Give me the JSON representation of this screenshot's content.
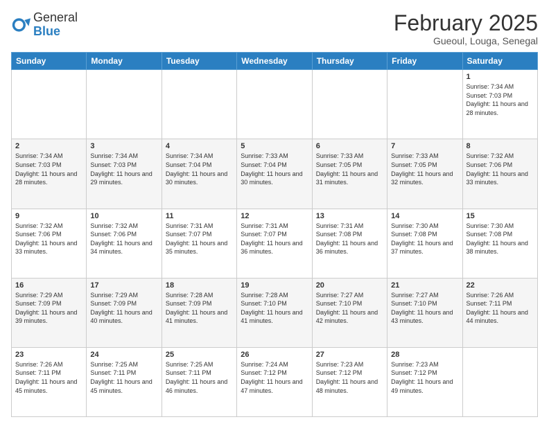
{
  "header": {
    "logo_general": "General",
    "logo_blue": "Blue",
    "month_title": "February 2025",
    "location": "Gueoul, Louga, Senegal"
  },
  "days_of_week": [
    "Sunday",
    "Monday",
    "Tuesday",
    "Wednesday",
    "Thursday",
    "Friday",
    "Saturday"
  ],
  "weeks": [
    [
      {
        "day": "",
        "info": ""
      },
      {
        "day": "",
        "info": ""
      },
      {
        "day": "",
        "info": ""
      },
      {
        "day": "",
        "info": ""
      },
      {
        "day": "",
        "info": ""
      },
      {
        "day": "",
        "info": ""
      },
      {
        "day": "1",
        "info": "Sunrise: 7:34 AM\nSunset: 7:03 PM\nDaylight: 11 hours and 28 minutes."
      }
    ],
    [
      {
        "day": "2",
        "info": "Sunrise: 7:34 AM\nSunset: 7:03 PM\nDaylight: 11 hours and 28 minutes."
      },
      {
        "day": "3",
        "info": "Sunrise: 7:34 AM\nSunset: 7:03 PM\nDaylight: 11 hours and 29 minutes."
      },
      {
        "day": "4",
        "info": "Sunrise: 7:34 AM\nSunset: 7:04 PM\nDaylight: 11 hours and 30 minutes."
      },
      {
        "day": "5",
        "info": "Sunrise: 7:33 AM\nSunset: 7:04 PM\nDaylight: 11 hours and 30 minutes."
      },
      {
        "day": "6",
        "info": "Sunrise: 7:33 AM\nSunset: 7:05 PM\nDaylight: 11 hours and 31 minutes."
      },
      {
        "day": "7",
        "info": "Sunrise: 7:33 AM\nSunset: 7:05 PM\nDaylight: 11 hours and 32 minutes."
      },
      {
        "day": "8",
        "info": "Sunrise: 7:32 AM\nSunset: 7:06 PM\nDaylight: 11 hours and 33 minutes."
      }
    ],
    [
      {
        "day": "9",
        "info": "Sunrise: 7:32 AM\nSunset: 7:06 PM\nDaylight: 11 hours and 33 minutes."
      },
      {
        "day": "10",
        "info": "Sunrise: 7:32 AM\nSunset: 7:06 PM\nDaylight: 11 hours and 34 minutes."
      },
      {
        "day": "11",
        "info": "Sunrise: 7:31 AM\nSunset: 7:07 PM\nDaylight: 11 hours and 35 minutes."
      },
      {
        "day": "12",
        "info": "Sunrise: 7:31 AM\nSunset: 7:07 PM\nDaylight: 11 hours and 36 minutes."
      },
      {
        "day": "13",
        "info": "Sunrise: 7:31 AM\nSunset: 7:08 PM\nDaylight: 11 hours and 36 minutes."
      },
      {
        "day": "14",
        "info": "Sunrise: 7:30 AM\nSunset: 7:08 PM\nDaylight: 11 hours and 37 minutes."
      },
      {
        "day": "15",
        "info": "Sunrise: 7:30 AM\nSunset: 7:08 PM\nDaylight: 11 hours and 38 minutes."
      }
    ],
    [
      {
        "day": "16",
        "info": "Sunrise: 7:29 AM\nSunset: 7:09 PM\nDaylight: 11 hours and 39 minutes."
      },
      {
        "day": "17",
        "info": "Sunrise: 7:29 AM\nSunset: 7:09 PM\nDaylight: 11 hours and 40 minutes."
      },
      {
        "day": "18",
        "info": "Sunrise: 7:28 AM\nSunset: 7:09 PM\nDaylight: 11 hours and 41 minutes."
      },
      {
        "day": "19",
        "info": "Sunrise: 7:28 AM\nSunset: 7:10 PM\nDaylight: 11 hours and 41 minutes."
      },
      {
        "day": "20",
        "info": "Sunrise: 7:27 AM\nSunset: 7:10 PM\nDaylight: 11 hours and 42 minutes."
      },
      {
        "day": "21",
        "info": "Sunrise: 7:27 AM\nSunset: 7:10 PM\nDaylight: 11 hours and 43 minutes."
      },
      {
        "day": "22",
        "info": "Sunrise: 7:26 AM\nSunset: 7:11 PM\nDaylight: 11 hours and 44 minutes."
      }
    ],
    [
      {
        "day": "23",
        "info": "Sunrise: 7:26 AM\nSunset: 7:11 PM\nDaylight: 11 hours and 45 minutes."
      },
      {
        "day": "24",
        "info": "Sunrise: 7:25 AM\nSunset: 7:11 PM\nDaylight: 11 hours and 45 minutes."
      },
      {
        "day": "25",
        "info": "Sunrise: 7:25 AM\nSunset: 7:11 PM\nDaylight: 11 hours and 46 minutes."
      },
      {
        "day": "26",
        "info": "Sunrise: 7:24 AM\nSunset: 7:12 PM\nDaylight: 11 hours and 47 minutes."
      },
      {
        "day": "27",
        "info": "Sunrise: 7:23 AM\nSunset: 7:12 PM\nDaylight: 11 hours and 48 minutes."
      },
      {
        "day": "28",
        "info": "Sunrise: 7:23 AM\nSunset: 7:12 PM\nDaylight: 11 hours and 49 minutes."
      },
      {
        "day": "",
        "info": ""
      }
    ]
  ]
}
